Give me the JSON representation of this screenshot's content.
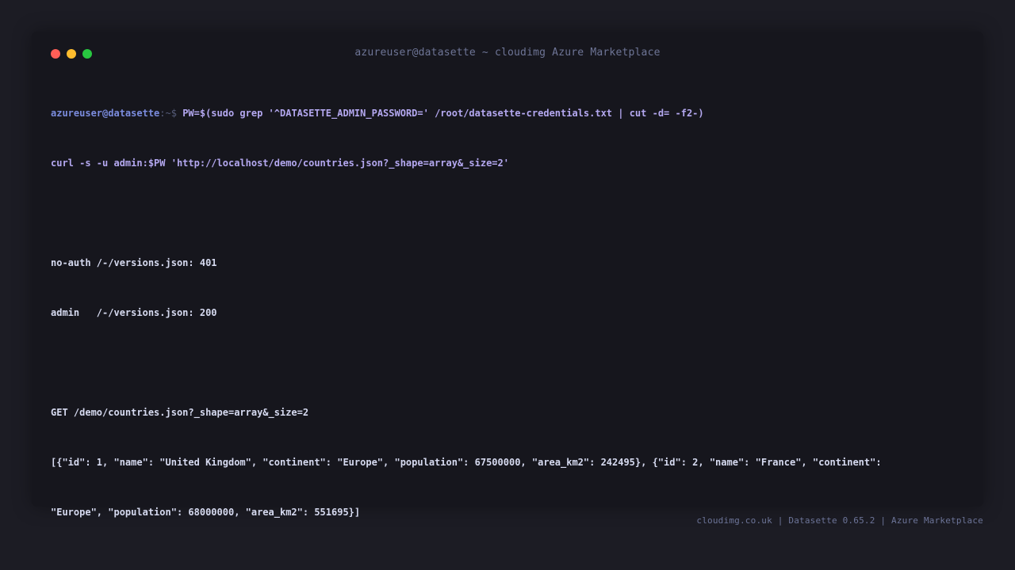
{
  "window": {
    "title": "azureuser@datasette ~ cloudimg Azure Marketplace"
  },
  "terminal": {
    "prompt_user": "azureuser@datasette",
    "prompt_path": ":~$ ",
    "command_line_1": "PW=$(sudo grep '^DATASETTE_ADMIN_PASSWORD=' /root/datasette-credentials.txt | cut -d= -f2-)",
    "command_line_2": "curl -s -u admin:$PW 'http://localhost/demo/countries.json?_shape=array&_size=2'",
    "output_noauth": "no-auth /-/versions.json: 401",
    "output_admin": "admin   /-/versions.json: 200",
    "output_get": "GET /demo/countries.json?_shape=array&_size=2",
    "output_json_1": "[{\"id\": 1, \"name\": \"United Kingdom\", \"continent\": \"Europe\", \"population\": 67500000, \"area_km2\": 242495}, {\"id\": 2, \"name\": \"France\", \"continent\":",
    "output_json_2": "\"Europe\", \"population\": 68000000, \"area_km2\": 551695}]"
  },
  "footer": {
    "text": "cloudimg.co.uk | Datasette 0.65.2 | Azure Marketplace"
  },
  "colors": {
    "close": "#ff5f57",
    "minimize": "#febc2e",
    "maximize": "#28c840",
    "prompt_user": "#7b8cde",
    "command": "#b4a8f0"
  }
}
